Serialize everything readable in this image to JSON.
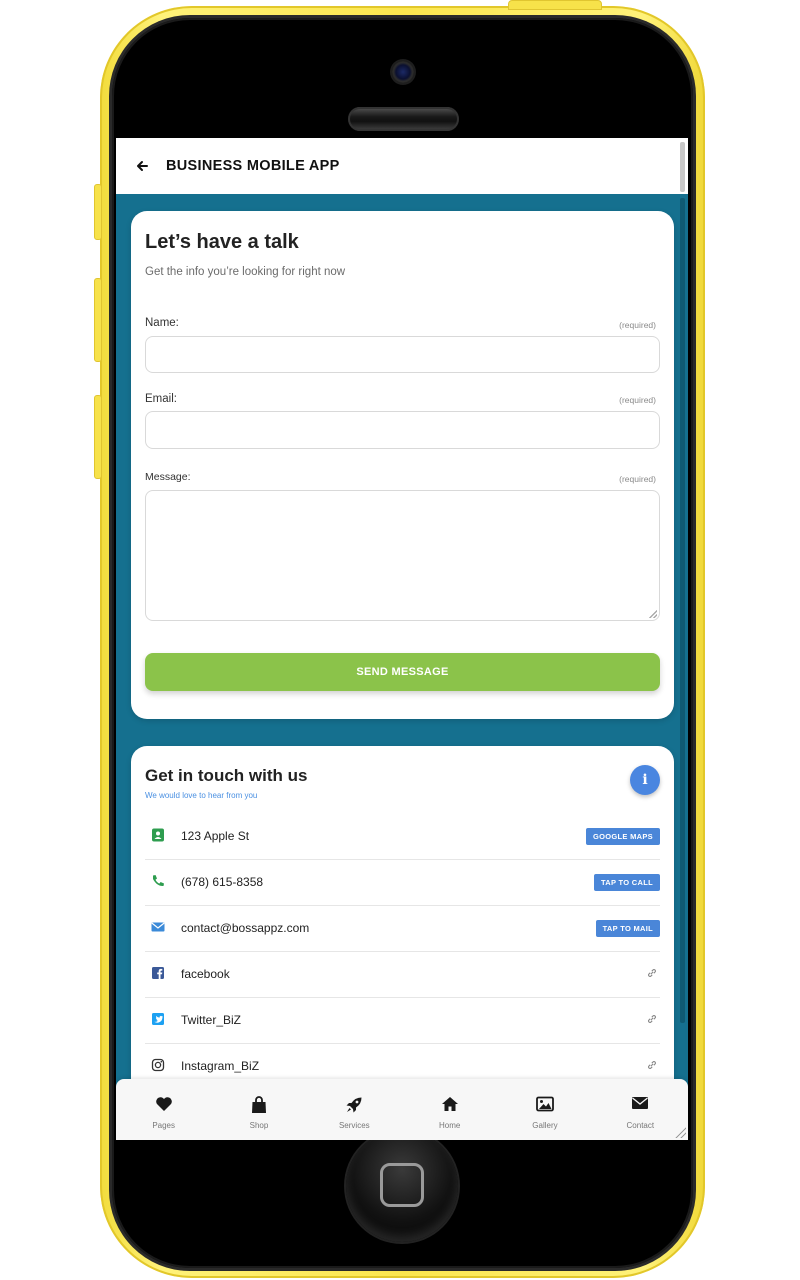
{
  "appbar": {
    "back_icon": "arrow-left-icon",
    "title": "BUSINESS MOBILE APP"
  },
  "form_card": {
    "title": "Let’s have a talk",
    "subtitle": "Get the info you’re looking for right now",
    "fields": [
      {
        "label": "Name:",
        "required_note": "(required)",
        "value": ""
      },
      {
        "label": "Email:",
        "required_note": "(required)",
        "value": ""
      },
      {
        "label": "Message:",
        "required_note": "(required)",
        "value": ""
      }
    ],
    "submit_label": "SEND MESSAGE",
    "submit_color": "#8bc34a"
  },
  "contact_card": {
    "title": "Get in touch with us",
    "subtitle": "We would love to hear from you",
    "info_icon": "info-icon",
    "rows": [
      {
        "icon": "address-card-icon",
        "icon_color": "#2e9d4f",
        "text": "123 Apple St",
        "action": "GOOGLE MAPS"
      },
      {
        "icon": "phone-icon",
        "icon_color": "#2e9d4f",
        "text": "(678) 615-8358",
        "action": "TAP TO CALL"
      },
      {
        "icon": "envelope-icon",
        "icon_color": "#3b8ad8",
        "text": "contact@bossappz.com",
        "action": "TAP TO MAIL"
      },
      {
        "icon": "facebook-icon",
        "icon_color": "#3b5998",
        "text": "facebook",
        "action_icon": "link-icon"
      },
      {
        "icon": "twitter-icon",
        "icon_color": "#1da1f2",
        "text": "Twitter_BiZ",
        "action_icon": "link-icon"
      },
      {
        "icon": "instagram-icon",
        "icon_color": "#333333",
        "text": "Instagram_BiZ",
        "action_icon": "link-icon"
      }
    ]
  },
  "bottom_nav": [
    {
      "label": "Pages",
      "icon": "heart-icon"
    },
    {
      "label": "Shop",
      "icon": "shopping-bag-icon"
    },
    {
      "label": "Services",
      "icon": "rocket-icon"
    },
    {
      "label": "Home",
      "icon": "home-icon"
    },
    {
      "label": "Gallery",
      "icon": "image-icon"
    },
    {
      "label": "Contact",
      "icon": "envelope-icon"
    }
  ],
  "colors": {
    "screen_background": "#15708f",
    "accent_blue": "#4a86d8",
    "phone_case": "#fbe64e"
  }
}
